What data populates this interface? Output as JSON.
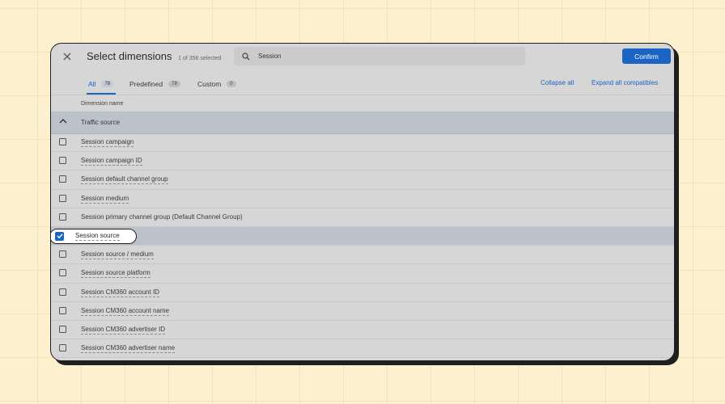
{
  "header": {
    "title": "Select dimensions",
    "selected_count": "1 of 356 selected",
    "confirm_label": "Confirm"
  },
  "search": {
    "value": "Session",
    "icon": "search-icon"
  },
  "tabs": [
    {
      "label": "All",
      "count": "78",
      "active": true
    },
    {
      "label": "Predefined",
      "count": "78",
      "active": false
    },
    {
      "label": "Custom",
      "count": "0",
      "active": false
    }
  ],
  "actions": {
    "collapse_all": "Collapse all",
    "expand_all": "Expand all compatibles"
  },
  "table": {
    "column_header": "Dimension name",
    "group": {
      "label": "Traffic source",
      "expanded": true
    },
    "rows": [
      {
        "label": "Session campaign",
        "checked": false
      },
      {
        "label": "Session campaign ID",
        "checked": false
      },
      {
        "label": "Session default channel group",
        "checked": false
      },
      {
        "label": "Session medium",
        "checked": false
      },
      {
        "label": "Session primary channel group (Default Channel Group)",
        "checked": false
      },
      {
        "label": "Session source",
        "checked": true
      },
      {
        "label": "Session source / medium",
        "checked": false
      },
      {
        "label": "Session source platform",
        "checked": false
      },
      {
        "label": "Session CM360 account ID",
        "checked": false
      },
      {
        "label": "Session CM360 account name",
        "checked": false
      },
      {
        "label": "Session CM360 advertiser ID",
        "checked": false
      },
      {
        "label": "Session CM360 advertiser name",
        "checked": false
      }
    ]
  },
  "colors": {
    "accent": "#1a65c4",
    "background": "#fcf0cf",
    "panel": "#d6d6d6",
    "selected_row": "#bbc2cc"
  }
}
